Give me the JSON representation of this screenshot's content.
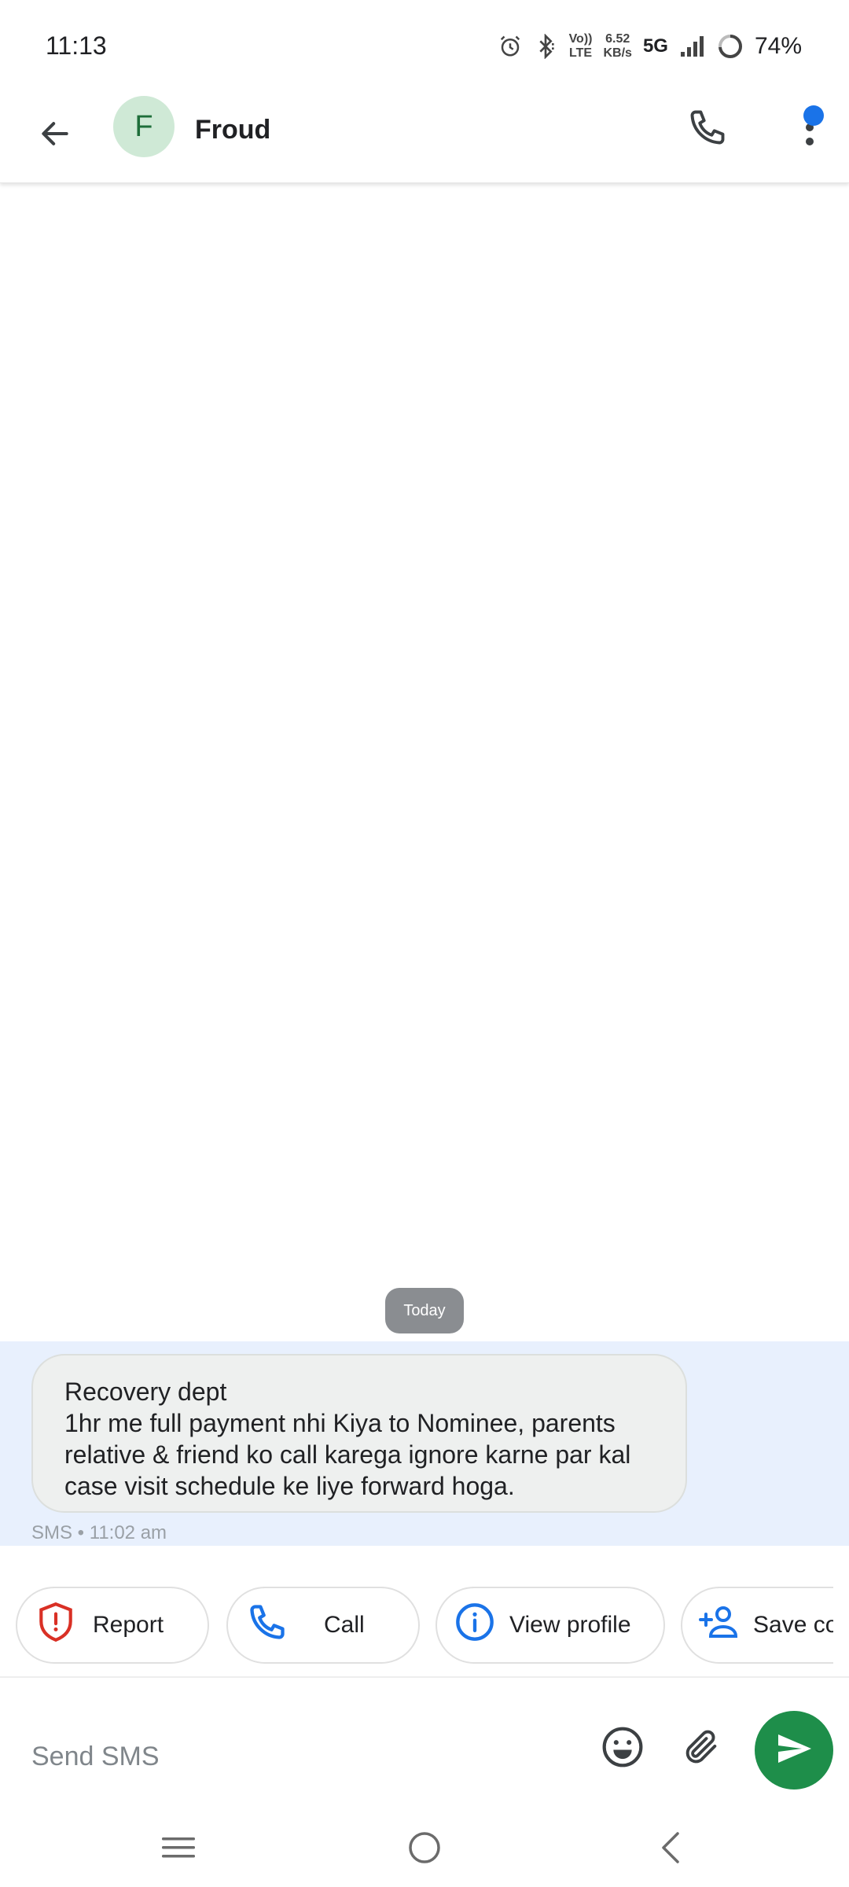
{
  "status_bar": {
    "time": "11:13",
    "network_rate_value": "6.52",
    "network_rate_unit": "KB/s",
    "volte_top": "Vo))",
    "volte_bottom": "LTE",
    "network_type": "5G",
    "battery": "74%",
    "icons": [
      "alarm-icon",
      "bluetooth-icon",
      "signal-icon",
      "battery-ring-icon"
    ]
  },
  "app_bar": {
    "back_icon": "arrow-back-icon",
    "avatar_letter": "F",
    "contact_name": "Froud",
    "call_icon": "phone-icon",
    "more_icon": "more-vert-icon",
    "accent": "#1a73e8"
  },
  "conversation": {
    "date_label": "Today",
    "message": {
      "text": "Recovery dept\n1hr me full payment nhi Kiya to Nominee, parents relative & friend ko call karega ignore karne par kal case visit schedule ke liye forward hoga.",
      "meta": "SMS • 11:02 am"
    }
  },
  "chips": [
    {
      "label": "Report",
      "icon": "report-shield-icon",
      "color": "#d93025"
    },
    {
      "label": "Call",
      "icon": "phone-icon",
      "color": "#1a73e8"
    },
    {
      "label": "View profile",
      "icon": "info-icon",
      "color": "#1a73e8"
    },
    {
      "label": "Save co",
      "icon": "add-person-icon",
      "color": "#1a73e8"
    }
  ],
  "compose": {
    "placeholder": "Send SMS",
    "value": "",
    "emoji_icon": "emoji-icon",
    "attach_icon": "attach-icon",
    "send_icon": "send-icon",
    "send_color": "#1e8e4a"
  },
  "nav_bar": {
    "items": [
      "menu-icon",
      "home-icon",
      "back-icon"
    ]
  }
}
